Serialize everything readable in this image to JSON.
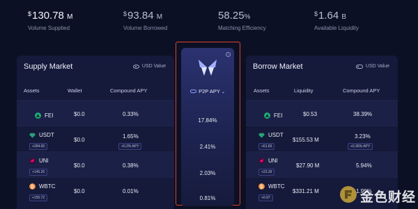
{
  "stats": [
    {
      "currency": "$",
      "value": "130.78",
      "suffix": "M",
      "label": "Volume Supplied"
    },
    {
      "currency": "$",
      "value": "93.84",
      "suffix": "M",
      "label": "Volume Borrowed"
    },
    {
      "currency": "",
      "value": "58.25",
      "suffix": "%",
      "label": "Matching Efficiency"
    },
    {
      "currency": "$",
      "value": "1.64",
      "suffix": "B",
      "label": "Available Liquidity"
    }
  ],
  "supply": {
    "title": "Supply Market",
    "usd_toggle": "USD Value",
    "columns": [
      "Assets",
      "Wallet",
      "Compound APY"
    ],
    "rows": [
      {
        "symbol": "FEI",
        "balance": "",
        "wallet": "$0.0",
        "apy": "0.33%",
        "boost": ""
      },
      {
        "symbol": "USDT",
        "balance": "+284.00",
        "wallet": "$0.0",
        "apy": "1.65%",
        "boost": "+0.2% APY"
      },
      {
        "symbol": "UNI",
        "balance": "+145.26",
        "wallet": "$0.0",
        "apy": "0.38%",
        "boost": ""
      },
      {
        "symbol": "WBTC",
        "balance": "+155.72",
        "wallet": "$0.0",
        "apy": "0.01%",
        "boost": ""
      }
    ]
  },
  "p2p": {
    "header": "P2P APY",
    "info": "i",
    "values": [
      "17.84%",
      "2.41%",
      "2.03%",
      "0.81%"
    ]
  },
  "borrow": {
    "title": "Borrow Market",
    "usd_toggle": "USD Value",
    "columns": [
      "Assets",
      "Liquidity",
      "Compound APY"
    ],
    "rows": [
      {
        "symbol": "FEI",
        "balance": "",
        "liquidity": "$0.53",
        "apy": "38.39%",
        "boost": ""
      },
      {
        "symbol": "USDT",
        "balance": "+61.83",
        "liquidity": "$155.53 M",
        "apy": "3.23%",
        "boost": "+0.36% APY"
      },
      {
        "symbol": "UNI",
        "balance": "+23.39",
        "liquidity": "$27.90 M",
        "apy": "5.94%",
        "boost": ""
      },
      {
        "symbol": "WBTC",
        "balance": "+0.97",
        "liquidity": "$331.21 M",
        "apy": "1.95%",
        "boost": ""
      }
    ]
  },
  "watermark": {
    "text": "金色财经"
  },
  "colors": {
    "background": "#0c1024",
    "panel": "#15193a",
    "highlight_border": "#e0432f",
    "fei": "#22b07d",
    "usdt": "#26a17b",
    "uni": "#ff007a",
    "wbtc": "#f09242"
  },
  "icons": {
    "fei": "fei-triangle-icon",
    "usdt": "tether-diamond-icon",
    "uni": "unicorn-icon",
    "wbtc": "bitcoin-icon",
    "logo": "butterfly-logo"
  }
}
